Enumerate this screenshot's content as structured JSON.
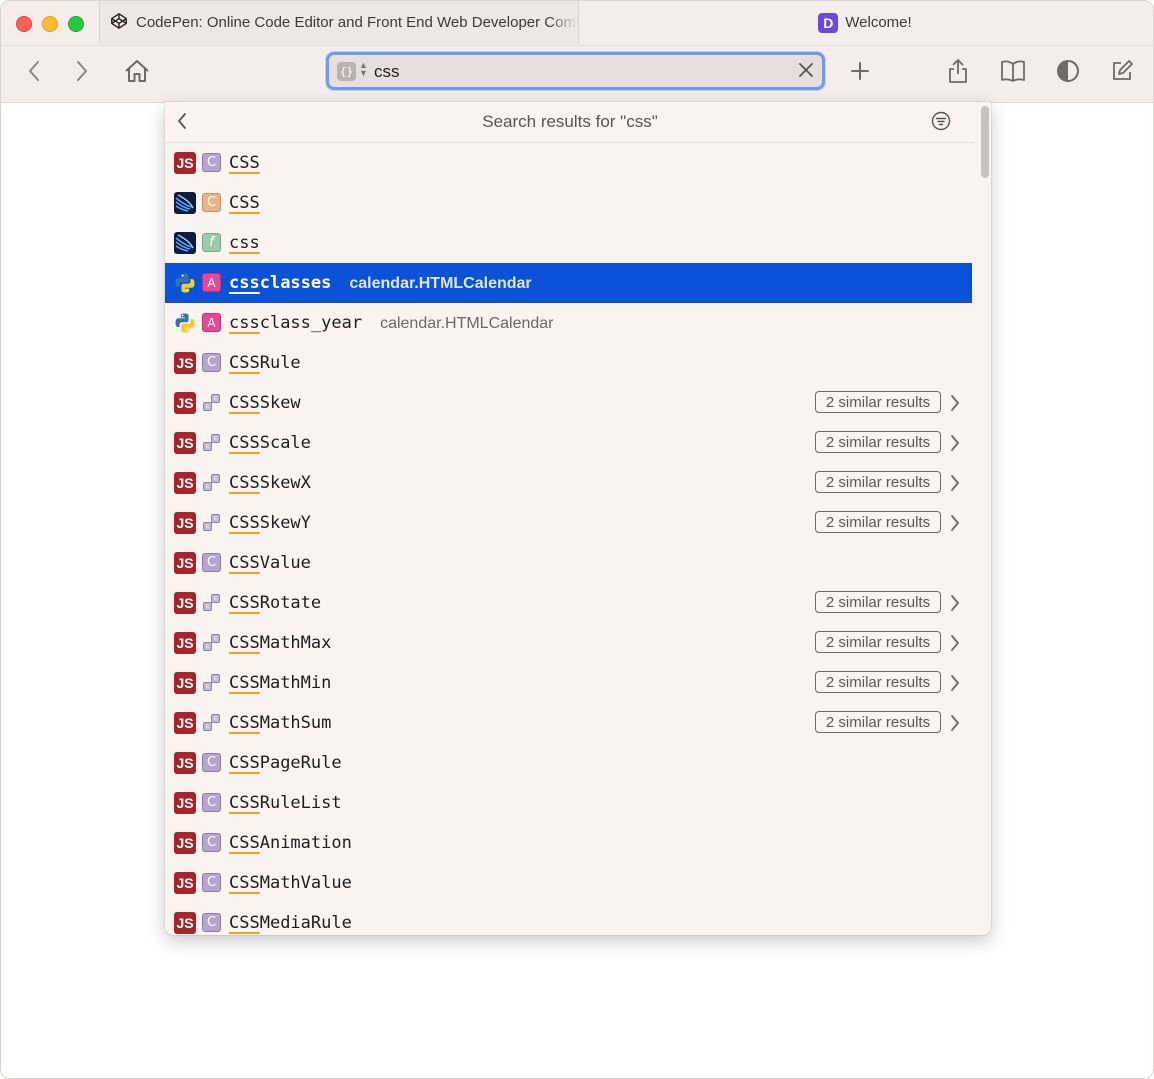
{
  "tabs": [
    {
      "title": "CodePen: Online Code Editor and Front End Web Developer Community",
      "icon": "codepen-icon",
      "active": true
    },
    {
      "title": "Welcome!",
      "icon": "devdocs-icon",
      "active": false
    }
  ],
  "address_bar": {
    "value": "css"
  },
  "dropdown": {
    "title": "Search results for \"css\"",
    "results": [
      {
        "lang": "js",
        "kind": "class",
        "match": "CSS",
        "rest": "",
        "context": "",
        "similar": ""
      },
      {
        "lang": "swift",
        "kind": "class-orange",
        "match": "CSS",
        "rest": "",
        "context": "",
        "similar": ""
      },
      {
        "lang": "swift",
        "kind": "func",
        "match": "css",
        "rest": "",
        "context": "",
        "similar": ""
      },
      {
        "lang": "python",
        "kind": "attr",
        "match": "css",
        "rest": "classes",
        "context": "calendar.HTMLCalendar",
        "similar": "",
        "selected": true
      },
      {
        "lang": "python",
        "kind": "attr",
        "match": "css",
        "rest": "class_year",
        "context": "calendar.HTMLCalendar",
        "similar": ""
      },
      {
        "lang": "js",
        "kind": "class",
        "match": "CSS",
        "rest": "Rule",
        "context": "",
        "similar": ""
      },
      {
        "lang": "js",
        "kind": "multi",
        "match": "CSS",
        "rest": "Skew",
        "context": "",
        "similar": "2 similar results"
      },
      {
        "lang": "js",
        "kind": "multi",
        "match": "CSS",
        "rest": "Scale",
        "context": "",
        "similar": "2 similar results"
      },
      {
        "lang": "js",
        "kind": "multi",
        "match": "CSS",
        "rest": "SkewX",
        "context": "",
        "similar": "2 similar results"
      },
      {
        "lang": "js",
        "kind": "multi",
        "match": "CSS",
        "rest": "SkewY",
        "context": "",
        "similar": "2 similar results"
      },
      {
        "lang": "js",
        "kind": "class",
        "match": "CSS",
        "rest": "Value",
        "context": "",
        "similar": ""
      },
      {
        "lang": "js",
        "kind": "multi",
        "match": "CSS",
        "rest": "Rotate",
        "context": "",
        "similar": "2 similar results"
      },
      {
        "lang": "js",
        "kind": "multi",
        "match": "CSS",
        "rest": "MathMax",
        "context": "",
        "similar": "2 similar results"
      },
      {
        "lang": "js",
        "kind": "multi",
        "match": "CSS",
        "rest": "MathMin",
        "context": "",
        "similar": "2 similar results"
      },
      {
        "lang": "js",
        "kind": "multi",
        "match": "CSS",
        "rest": "MathSum",
        "context": "",
        "similar": "2 similar results"
      },
      {
        "lang": "js",
        "kind": "class",
        "match": "CSS",
        "rest": "PageRule",
        "context": "",
        "similar": ""
      },
      {
        "lang": "js",
        "kind": "class",
        "match": "CSS",
        "rest": "RuleList",
        "context": "",
        "similar": ""
      },
      {
        "lang": "js",
        "kind": "class",
        "match": "CSS",
        "rest": "Animation",
        "context": "",
        "similar": ""
      },
      {
        "lang": "js",
        "kind": "class",
        "match": "CSS",
        "rest": "MathValue",
        "context": "",
        "similar": ""
      },
      {
        "lang": "js",
        "kind": "class",
        "match": "CSS",
        "rest": "MediaRule",
        "context": "",
        "similar": ""
      }
    ]
  },
  "colors": {
    "accent": "#0a53d8",
    "js_badge": "#a3262d",
    "match_underline": "#e2a81e"
  }
}
